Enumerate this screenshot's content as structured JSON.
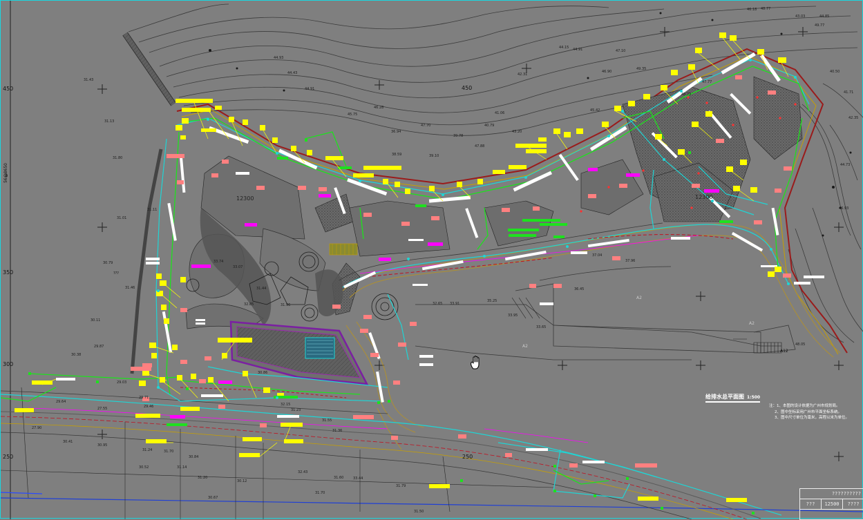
{
  "drawing": {
    "grid_labels": {
      "left": [
        "450",
        "350",
        "300",
        "250"
      ],
      "top": [
        "450"
      ],
      "right_marker": "A12",
      "bottom_road": "250"
    },
    "building_labels": [
      "12300",
      "12300"
    ],
    "zone_labels": [
      "A2",
      "A2",
      "A2"
    ],
    "spot_elevations": [
      "27.90",
      "29.64",
      "27.55",
      "31.43",
      "31.13",
      "31.80",
      "31.01",
      "31.11",
      "30.79",
      "31.46",
      "30.11",
      "29.87",
      "30.38",
      "29.03",
      "29.71",
      "29.46",
      "30.41",
      "30.95",
      "31.24",
      "31.70",
      "30.84",
      "30.52",
      "31.14",
      "31.20",
      "30.12",
      "30.67",
      "33.74",
      "33.07",
      "32.85",
      "31.44",
      "31.96",
      "30.86",
      "32.15",
      "31.23",
      "31.55",
      "31.36",
      "31.60",
      "32.43",
      "33.44",
      "31.70",
      "31.79",
      "31.50",
      "32.65",
      "33.91",
      "35.25",
      "33.95",
      "33.65",
      "36.45",
      "37.04",
      "37.96",
      "36.94",
      "38.59",
      "39.10",
      "39.78",
      "40.79",
      "41.06",
      "42.31",
      "43.20",
      "44.15",
      "44.91",
      "45.42",
      "46.90",
      "47.10",
      "49.35",
      "48.73",
      "47.77",
      "46.18",
      "43.03",
      "44.85",
      "40.50",
      "41.71",
      "42.35",
      "44.73",
      "46.93",
      "48.05"
    ],
    "contour_values": [
      "44.93",
      "44.43",
      "44.91",
      "45.75",
      "46.28",
      "47.70",
      "47.88",
      "48.77",
      "49.77"
    ],
    "axis_vertical_label": "56@8650",
    "left_coordinate": "3",
    "grid_tick": "???",
    "title": "给排水总平面图",
    "title_scale": "1:500",
    "notes": [
      "注：1、本图的设计依据为广州市规划局。",
      "2、图中坐标采用广州市平面坐标系统。",
      "3、图中尺寸单位为毫米，高程以米为单位。"
    ],
    "titleblock": {
      "row1": "??????????",
      "row2": [
        "???",
        "12500",
        "????"
      ]
    },
    "hover_cursor": "hand-cursor"
  },
  "colors": {
    "background": "#7f7f7f",
    "water_line_cyan": "#1fd5d5",
    "green_pipe": "#1ee11e",
    "label_yellow": "#ffff00",
    "label_white": "#ffffff",
    "label_red": "#ff8080",
    "label_magenta": "#ff00ff",
    "boundary_red": "#c01020",
    "purple_building": "#7b1fa2"
  }
}
